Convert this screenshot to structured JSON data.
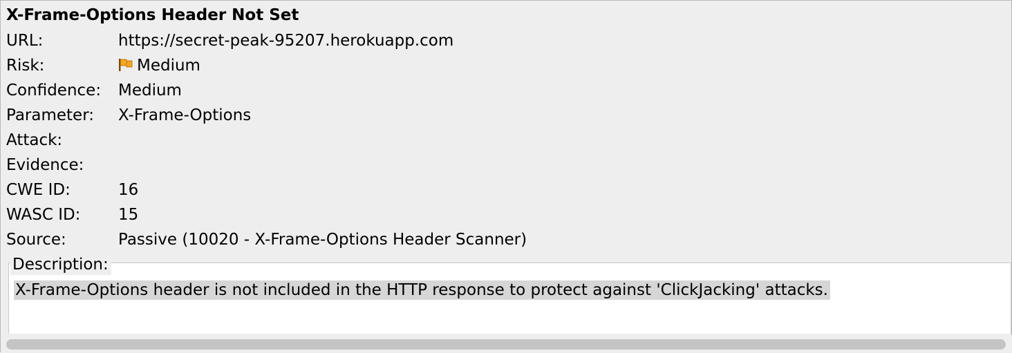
{
  "alert": {
    "title": "X-Frame-Options Header Not Set",
    "fields": {
      "url": {
        "label": "URL:",
        "value": "https://secret-peak-95207.herokuapp.com"
      },
      "risk": {
        "label": "Risk:",
        "value": "Medium",
        "icon": "orange-flag-icon"
      },
      "confidence": {
        "label": "Confidence:",
        "value": "Medium"
      },
      "parameter": {
        "label": "Parameter:",
        "value": "X-Frame-Options"
      },
      "attack": {
        "label": "Attack:",
        "value": ""
      },
      "evidence": {
        "label": "Evidence:",
        "value": ""
      },
      "cwe_id": {
        "label": "CWE ID:",
        "value": "16"
      },
      "wasc_id": {
        "label": "WASC ID:",
        "value": "15"
      },
      "source": {
        "label": "Source:",
        "value": "Passive (10020 - X-Frame-Options Header Scanner)"
      }
    },
    "description": {
      "legend": "Description:",
      "text": "X-Frame-Options header is not included in the HTTP response to protect against 'ClickJacking' attacks."
    }
  },
  "colors": {
    "panel_background": "#eeeeee",
    "selection_highlight": "#d6d6d6",
    "risk_flag": "#f5a623"
  }
}
